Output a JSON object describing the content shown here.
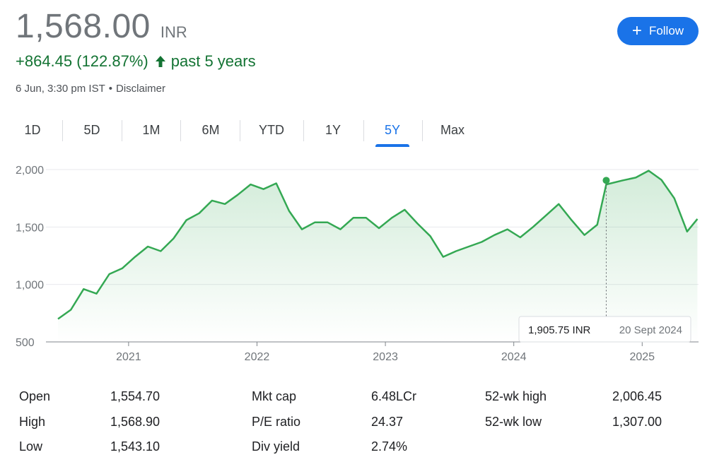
{
  "quote": {
    "price": "1,568.00",
    "currency": "INR",
    "change": "+864.45 (122.87%)",
    "period": "past 5 years",
    "timestamp": "6 Jun, 3:30 pm IST",
    "separator": "•",
    "disclaimer": "Disclaimer"
  },
  "follow_button": {
    "label": "Follow",
    "color": "#1a73e8"
  },
  "tabs": [
    {
      "label": "1D"
    },
    {
      "label": "5D"
    },
    {
      "label": "1M"
    },
    {
      "label": "6M"
    },
    {
      "label": "YTD"
    },
    {
      "label": "1Y"
    },
    {
      "label": "5Y",
      "active": true
    },
    {
      "label": "Max"
    }
  ],
  "chart_data": {
    "type": "area",
    "line_color": "#34a853",
    "y_ticks": [
      "2,000",
      "1,500",
      "1,000",
      "500"
    ],
    "ylim": [
      500,
      2000
    ],
    "x_ticks": [
      "2021",
      "2022",
      "2023",
      "2024",
      "2025"
    ],
    "x": [
      2020.45,
      2020.55,
      2020.65,
      2020.75,
      2020.85,
      2020.95,
      2021.05,
      2021.15,
      2021.25,
      2021.35,
      2021.45,
      2021.55,
      2021.65,
      2021.75,
      2021.85,
      2021.95,
      2022.05,
      2022.15,
      2022.25,
      2022.35,
      2022.45,
      2022.55,
      2022.65,
      2022.75,
      2022.85,
      2022.95,
      2023.05,
      2023.15,
      2023.25,
      2023.35,
      2023.45,
      2023.55,
      2023.65,
      2023.75,
      2023.85,
      2023.95,
      2024.05,
      2024.15,
      2024.25,
      2024.35,
      2024.45,
      2024.55,
      2024.65,
      2024.72,
      2024.85,
      2024.95,
      2025.05,
      2025.15,
      2025.25,
      2025.35,
      2025.43
    ],
    "y": [
      700,
      780,
      960,
      920,
      1090,
      1140,
      1240,
      1330,
      1290,
      1400,
      1560,
      1620,
      1730,
      1700,
      1780,
      1870,
      1830,
      1880,
      1640,
      1480,
      1540,
      1540,
      1480,
      1580,
      1580,
      1490,
      1580,
      1650,
      1530,
      1420,
      1240,
      1290,
      1330,
      1370,
      1430,
      1480,
      1410,
      1500,
      1600,
      1700,
      1560,
      1430,
      1520,
      1870,
      1905.75,
      1930,
      1990,
      1910,
      1750,
      1460,
      1570
    ],
    "tooltip": {
      "value": "1,905.75 INR",
      "date": "20 Sept 2024",
      "x": 2024.72,
      "y": 1905.75
    }
  },
  "stats": [
    [
      {
        "label": "Open",
        "value": "1,554.70"
      },
      {
        "label": "High",
        "value": "1,568.90"
      },
      {
        "label": "Low",
        "value": "1,543.10"
      }
    ],
    [
      {
        "label": "Mkt cap",
        "value": "6.48LCr"
      },
      {
        "label": "P/E ratio",
        "value": "24.37"
      },
      {
        "label": "Div yield",
        "value": "2.74%"
      }
    ],
    [
      {
        "label": "52-wk high",
        "value": "2,006.45"
      },
      {
        "label": "52-wk low",
        "value": "1,307.00"
      }
    ]
  ]
}
